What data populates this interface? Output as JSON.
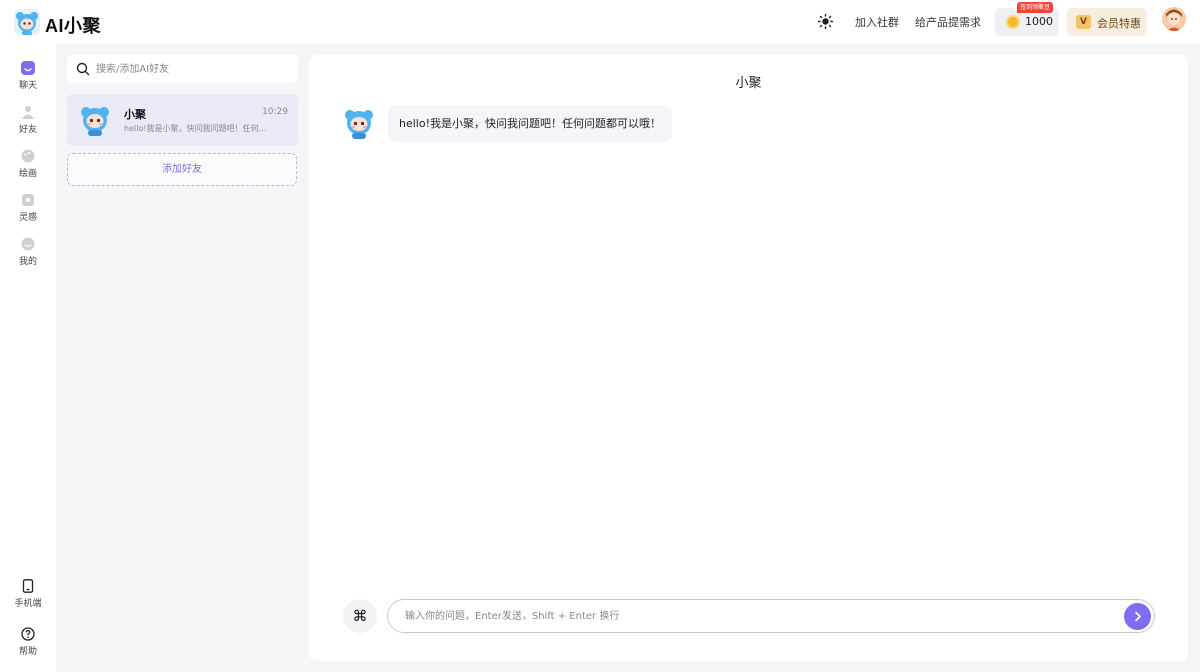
{
  "header": {
    "brand": "AI小聚",
    "links": [
      "加入社群",
      "给产品提需求"
    ],
    "coins": {
      "badge": "签到领聚豆",
      "count": "1000"
    },
    "vip_label": "会员特惠"
  },
  "nav": {
    "items": [
      {
        "label": "聊天",
        "icon": "chat-icon"
      },
      {
        "label": "好友",
        "icon": "friends-icon"
      },
      {
        "label": "绘画",
        "icon": "palette-icon"
      },
      {
        "label": "灵感",
        "icon": "inspiration-icon"
      },
      {
        "label": "我的",
        "icon": "profile-icon"
      }
    ],
    "bottom": [
      {
        "label": "手机端",
        "icon": "mobile-icon"
      },
      {
        "label": "帮助",
        "icon": "help-icon"
      }
    ]
  },
  "contacts": {
    "search_placeholder": "搜索/添加AI好友",
    "items": [
      {
        "name": "小聚",
        "time": "10:29",
        "preview": "hello!我是小聚，快问我问题吧！任何问题都可以哦！"
      }
    ],
    "add_friend_label": "添加好友"
  },
  "chat": {
    "title": "小聚",
    "messages": [
      {
        "from": "bot",
        "text": "hello!我是小聚，快问我问题吧！任何问题都可以哦！"
      }
    ],
    "command_symbol": "⌘",
    "input_placeholder": "输入你的问题，Enter发送，Shift + Enter 换行"
  },
  "colors": {
    "accent": "#7f6df0",
    "selected_bg": "#eae9f6",
    "coin": "#f5b82e",
    "vip_bg": "#f7eedf",
    "badge": "#f0443d"
  }
}
